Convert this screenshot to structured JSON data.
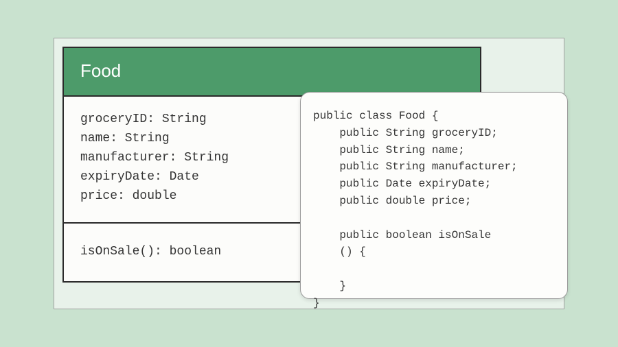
{
  "uml": {
    "className": "Food",
    "attributes": [
      "groceryID: String",
      "name: String",
      "manufacturer: String",
      "expiryDate: Date",
      "price: double"
    ],
    "methods": [
      "isOnSale(): boolean"
    ]
  },
  "code": {
    "text": "public class Food {\n    public String groceryID;\n    public String name;\n    public String manufacturer;\n    public Date expiryDate;\n    public double price;\n\n    public boolean isOnSale\n    () {\n\n    }\n}"
  }
}
